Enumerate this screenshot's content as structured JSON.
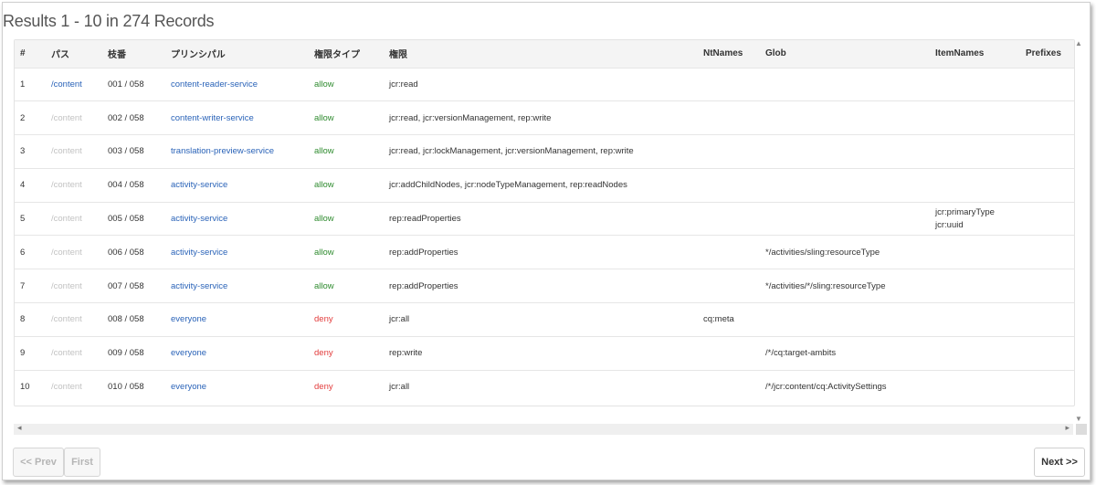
{
  "title": "Results 1 - 10 in 274 Records",
  "columns": [
    "#",
    "パス",
    "枝番",
    "プリンシパル",
    "権限タイプ",
    "権限",
    "NtNames",
    "Glob",
    "ItemNames",
    "Prefixes"
  ],
  "rows": [
    {
      "num": "1",
      "path": "/content",
      "branch": "001 / 058",
      "principal": "content-reader-service",
      "type": "allow",
      "priv": "jcr:read",
      "nt": "",
      "glob": "",
      "items": [
        "",
        ""
      ],
      "prefixes": ""
    },
    {
      "num": "2",
      "path": "/content",
      "branch": "002 / 058",
      "principal": "content-writer-service",
      "type": "allow",
      "priv": "jcr:read, jcr:versionManagement, rep:write",
      "nt": "",
      "glob": "",
      "items": [
        "",
        ""
      ],
      "prefixes": ""
    },
    {
      "num": "3",
      "path": "/content",
      "branch": "003 / 058",
      "principal": "translation-preview-service",
      "type": "allow",
      "priv": "jcr:read, jcr:lockManagement, jcr:versionManagement, rep:write",
      "nt": "",
      "glob": "",
      "items": [
        "",
        ""
      ],
      "prefixes": ""
    },
    {
      "num": "4",
      "path": "/content",
      "branch": "004 / 058",
      "principal": "activity-service",
      "type": "allow",
      "priv": "jcr:addChildNodes, jcr:nodeTypeManagement, rep:readNodes",
      "nt": "",
      "glob": "",
      "items": [
        "",
        ""
      ],
      "prefixes": ""
    },
    {
      "num": "5",
      "path": "/content",
      "branch": "005 / 058",
      "principal": "activity-service",
      "type": "allow",
      "priv": "rep:readProperties",
      "nt": "",
      "glob": "",
      "items": [
        "jcr:primaryType",
        "jcr:uuid"
      ],
      "prefixes": ""
    },
    {
      "num": "6",
      "path": "/content",
      "branch": "006 / 058",
      "principal": "activity-service",
      "type": "allow",
      "priv": "rep:addProperties",
      "nt": "",
      "glob": "*/activities/sling:resourceType",
      "items": [
        "",
        ""
      ],
      "prefixes": ""
    },
    {
      "num": "7",
      "path": "/content",
      "branch": "007 / 058",
      "principal": "activity-service",
      "type": "allow",
      "priv": "rep:addProperties",
      "nt": "",
      "glob": "*/activities/*/sling:resourceType",
      "items": [
        "",
        ""
      ],
      "prefixes": ""
    },
    {
      "num": "8",
      "path": "/content",
      "branch": "008 / 058",
      "principal": "everyone",
      "type": "deny",
      "priv": "jcr:all",
      "nt": "cq:meta",
      "glob": "",
      "items": [
        "",
        ""
      ],
      "prefixes": ""
    },
    {
      "num": "9",
      "path": "/content",
      "branch": "009 / 058",
      "principal": "everyone",
      "type": "deny",
      "priv": "rep:write",
      "nt": "",
      "glob": "/*/cq:target-ambits",
      "items": [
        "",
        ""
      ],
      "prefixes": ""
    },
    {
      "num": "10",
      "path": "/content",
      "branch": "010 / 058",
      "principal": "everyone",
      "type": "deny",
      "priv": "jcr:all",
      "nt": "",
      "glob": "/*/jcr:content/cq:ActivitySettings",
      "items": [
        "",
        ""
      ],
      "prefixes": ""
    }
  ],
  "pagination": {
    "prev": "<< Prev",
    "first": "First",
    "next": "Next >>"
  },
  "icons": {
    "scroll_up": "chevron-up-icon",
    "scroll_down": "chevron-down-icon",
    "scroll_left": "chevron-left-icon",
    "scroll_right": "chevron-right-icon"
  },
  "colors": {
    "link": "#2a63b8",
    "allow": "#2e8b2e",
    "deny": "#e23b3b",
    "muted_path": "#c2c2c2"
  }
}
